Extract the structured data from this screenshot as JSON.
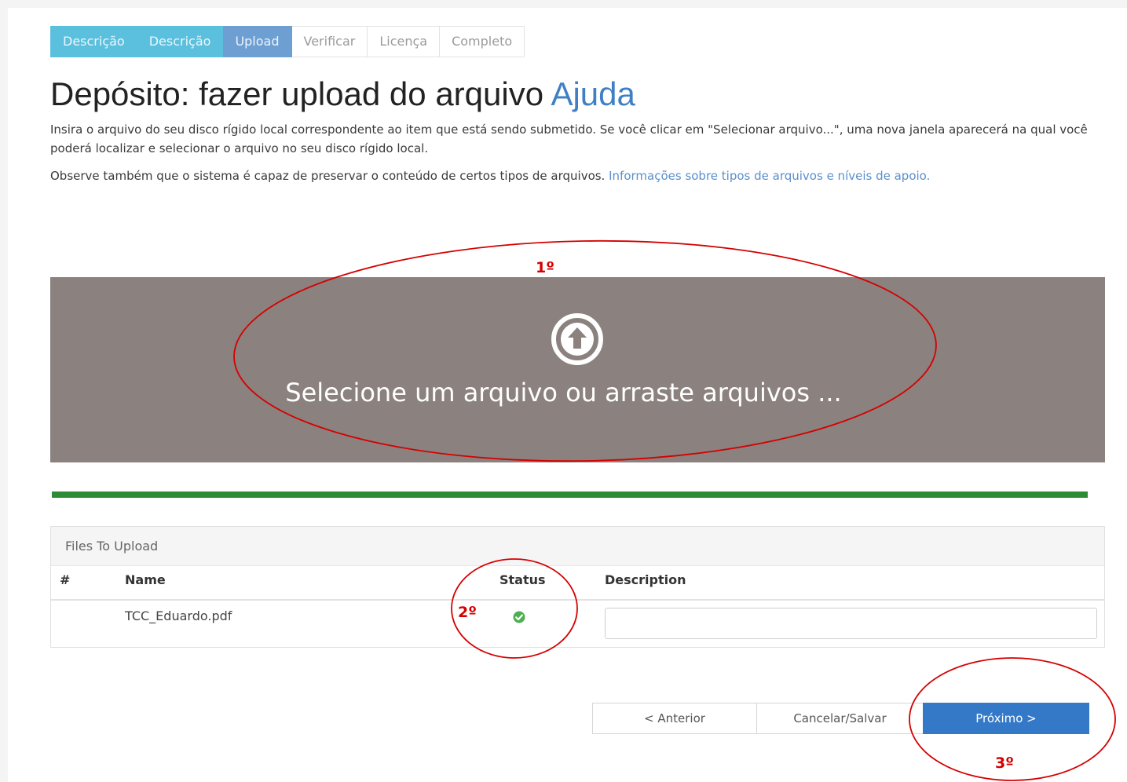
{
  "steps": [
    {
      "label": "Descrição",
      "state": "done"
    },
    {
      "label": "Descrição",
      "state": "done"
    },
    {
      "label": "Upload",
      "state": "current"
    },
    {
      "label": "Verificar",
      "state": "todo"
    },
    {
      "label": "Licença",
      "state": "todo"
    },
    {
      "label": "Completo",
      "state": "todo"
    }
  ],
  "title": {
    "text": "Depósito: fazer upload do arquivo",
    "help": "Ajuda"
  },
  "intro": {
    "line1": "Insira o arquivo do seu disco rígido local correspondente ao item que está sendo submetido. Se você clicar em \"Selecionar arquivo...\", uma nova janela aparecerá na qual você poderá localizar e selecionar o arquivo no seu disco rígido local.",
    "line2": "Observe também que o sistema é capaz de preservar o conteúdo de certos tipos de arquivos.",
    "link": "Informações sobre tipos de arquivos e níveis de apoio."
  },
  "dropzone": {
    "icon": "upload-circle-icon",
    "text": "Selecione um arquivo ou arraste arquivos ..."
  },
  "upload_progress": 1.0,
  "files_panel": {
    "heading": "Files To Upload",
    "columns": {
      "num": "#",
      "name": "Name",
      "status": "Status",
      "description": "Description"
    },
    "rows": [
      {
        "name": "TCC_Eduardo.pdf",
        "status_icon": "check-circle-icon",
        "description": ""
      }
    ]
  },
  "buttons": {
    "prev": "< Anterior",
    "cancel": "Cancelar/Salvar",
    "next": "Próximo >"
  },
  "annotations": {
    "first": "1º",
    "second": "2º",
    "third": "3º"
  },
  "colors": {
    "done_step": "#5bc0de",
    "current_step": "#6d9fd2",
    "dropzone": "#8b817e",
    "progress": "#2e8b35",
    "primary_button": "#3479c8",
    "annotation": "#d50000",
    "status_ok": "#4caf50"
  }
}
